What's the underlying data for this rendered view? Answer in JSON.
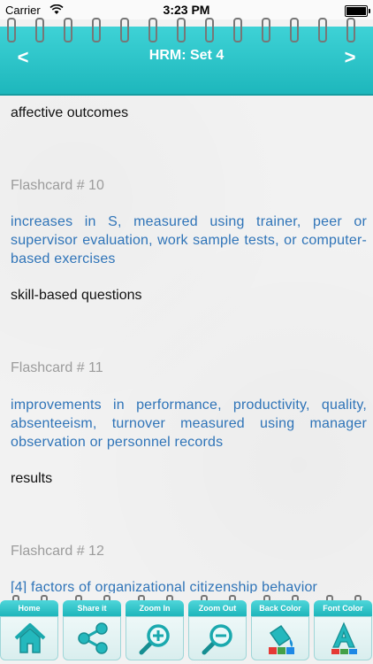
{
  "status": {
    "carrier": "Carrier",
    "time": "3:23 PM"
  },
  "nav": {
    "title": "HRM: Set 4",
    "back_icon": "<",
    "forward_icon": ">"
  },
  "content": {
    "prev_answer": "affective outcomes",
    "cards": [
      {
        "heading": "Flashcard # 10",
        "question": "increases in S, measured using trainer, peer or supervisor evaluation, work sample tests, or computer-based exercises",
        "answer": "skill-based questions"
      },
      {
        "heading": "Flashcard # 11",
        "question": "improvements in performance, productivity, quality, absenteeism, turnover measured using manager observation or personnel records",
        "answer": "results"
      },
      {
        "heading": "Flashcard # 12",
        "question": "[4] factors of organizational citizenship behavior"
      }
    ]
  },
  "toolbar": {
    "home": "Home",
    "share": "Share it",
    "zoom_in": "Zoom In",
    "zoom_out": "Zoom Out",
    "back_color": "Back Color",
    "font_color": "Font Color"
  },
  "colors": {
    "accent": "#1db7bc",
    "question_text": "#2f74b8",
    "heading_text": "#9c9c9c"
  }
}
